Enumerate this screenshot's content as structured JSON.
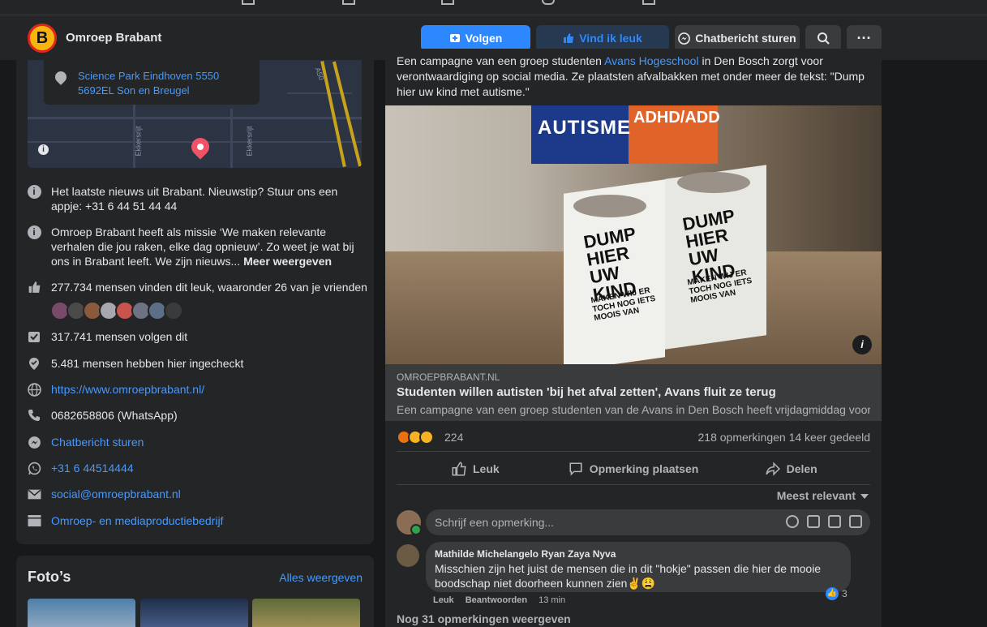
{
  "page": {
    "name": "Omroep Brabant",
    "logo_letter": "B"
  },
  "header": {
    "follow": "Volgen",
    "like": "Vind ik leuk",
    "chat": "Chatbericht sturen",
    "more": "···"
  },
  "about": {
    "address_line1": "Science Park Eindhoven 5550",
    "address_line2": "5692EL Son en Breugel",
    "map_label_1": "A50",
    "map_label_2": "Ekkersrijt",
    "map_label_3": "Ekkersrijt",
    "intro": "Het laatste nieuws uit Brabant. Nieuwstip? Stuur ons een appje: +31 6 44 51 44 44",
    "mission": "Omroep Brabant heeft als missie ‘We maken relevante verhalen die jou raken, elke dag opnieuw’. Zo weet je wat bij ons in Brabant leeft. We zijn nieuws...",
    "mission_more": "Meer weergeven",
    "likes": "277.734 mensen vinden dit leuk, waaronder 26 van je vrienden",
    "follows": "317.741 mensen volgen dit",
    "checkins": "5.481 mensen hebben hier ingecheckt",
    "website": "https://www.omroepbrabant.nl/",
    "whatsapp": "0682658806 (WhatsApp)",
    "messenger": "Chatbericht sturen",
    "phone": "+31 6 44514444",
    "email": "social@omroepbrabant.nl",
    "category": "Omroep- en mediaproductiebedrijf"
  },
  "photos": {
    "title": "Foto’s",
    "see_all": "Alles weergeven"
  },
  "post": {
    "intro_pre": "Een campagne van een groep studenten ",
    "intro_link": "Avans Hogeschool",
    "intro_post": " in Den Bosch zorgt voor verontwaardiging op social media. Ze plaatsten afvalbakken met onder meer de tekst: \"Dump hier uw kind met autisme.\"",
    "image_sign_left": "AUTISME",
    "image_sign_right": "ADHD/ADD",
    "image_bin_text_1": "DUMP HIER UW KIND",
    "image_bin_sub_1": "MAKEN WIJ ER TOCH NOG IETS MOOIS VAN",
    "image_bin_text_2": "DUMP HIER UW KIND",
    "image_bin_sub_2": "MAKEN WIJ ER TOCH NOG IETS MOOIS VAN",
    "link_domain": "OMROEPBRABANT.NL",
    "link_title": "Studenten willen autisten 'bij het afval zetten', Avans fluit ze terug",
    "link_desc": "Een campagne van een groep studenten van de Avans in Den Bosch heeft vrijdagmiddag voor ...",
    "reaction_count": "224",
    "comments_shares": "218 opmerkingen  14 keer gedeeld",
    "action_like": "Leuk",
    "action_comment": "Opmerking plaatsen",
    "action_share": "Delen",
    "sort_label": "Meest relevant",
    "compose_placeholder": "Schrijf een opmerking..."
  },
  "comment": {
    "author": "Mathilde Michelangelo Ryan Zaya Nyva",
    "text": "Misschien zijn het juist de mensen die in dit \"hokje\" passen die hier de mooie boodschap niet doorheen kunnen zien✌😩",
    "like": "Leuk",
    "reply": "Beantwoorden",
    "time": "13 min",
    "reactions": "3"
  },
  "more_comments": "Nog 31 opmerkingen weergeven",
  "colors": {
    "accent": "#2d88ff",
    "background": "#18191a",
    "card": "#242526"
  }
}
